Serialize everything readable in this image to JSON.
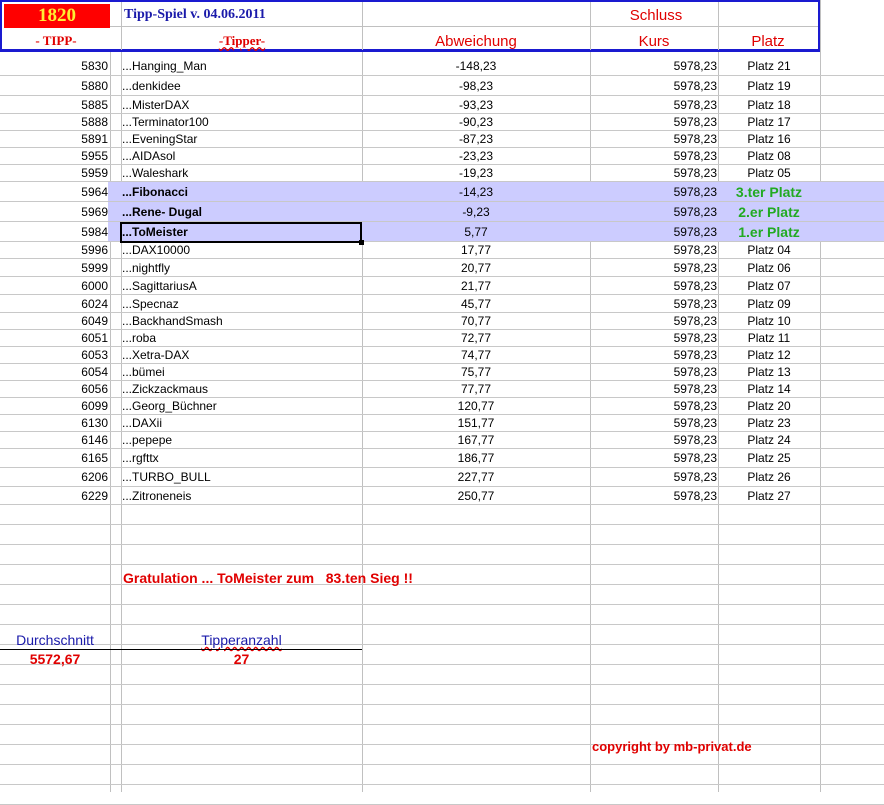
{
  "header": {
    "badge": "1820",
    "title": "Tipp-Spiel v. 04.06.2011",
    "schluss": "Schluss",
    "col_tipp": "- TIPP-",
    "col_tipper": "-Tipper-",
    "col_abweichung": "Abweichung",
    "col_kurs": "Kurs",
    "col_platz": "Platz"
  },
  "rows": [
    {
      "tipp": "5830",
      "tipper": "...Hanging_Man",
      "abw": "-148,23",
      "kurs": "5978,23",
      "platz": "Platz 21"
    },
    {
      "tipp": "5880",
      "tipper": "...denkidee",
      "abw": "-98,23",
      "kurs": "5978,23",
      "platz": "Platz 19"
    },
    {
      "tipp": "5885",
      "tipper": "...MisterDAX",
      "abw": "-93,23",
      "kurs": "5978,23",
      "platz": "Platz 18"
    },
    {
      "tipp": "5888",
      "tipper": "...Terminator100",
      "abw": "-90,23",
      "kurs": "5978,23",
      "platz": "Platz 17"
    },
    {
      "tipp": "5891",
      "tipper": "...EveningStar",
      "abw": "-87,23",
      "kurs": "5978,23",
      "platz": "Platz 16"
    },
    {
      "tipp": "5955",
      "tipper": "...AIDAsol",
      "abw": "-23,23",
      "kurs": "5978,23",
      "platz": "Platz 08"
    },
    {
      "tipp": "5959",
      "tipper": "...Waleshark",
      "abw": "-19,23",
      "kurs": "5978,23",
      "platz": "Platz 05"
    },
    {
      "tipp": "5964",
      "tipper": "...Fibonacci",
      "abw": "-14,23",
      "kurs": "5978,23",
      "platz": "3.ter Platz",
      "winner": true
    },
    {
      "tipp": "5969",
      "tipper": "...Rene- Dugal",
      "abw": "-9,23",
      "kurs": "5978,23",
      "platz": "2.er Platz",
      "winner": true
    },
    {
      "tipp": "5984",
      "tipper": "...ToMeister",
      "abw": "5,77",
      "kurs": "5978,23",
      "platz": "1.er Platz",
      "winner": true
    },
    {
      "tipp": "5996",
      "tipper": "...DAX10000",
      "abw": "17,77",
      "kurs": "5978,23",
      "platz": "Platz 04"
    },
    {
      "tipp": "5999",
      "tipper": "...nightfly",
      "abw": "20,77",
      "kurs": "5978,23",
      "platz": "Platz 06"
    },
    {
      "tipp": "6000",
      "tipper": "...SagittariusA",
      "abw": "21,77",
      "kurs": "5978,23",
      "platz": "Platz 07"
    },
    {
      "tipp": "6024",
      "tipper": "...Specnaz",
      "abw": "45,77",
      "kurs": "5978,23",
      "platz": "Platz 09"
    },
    {
      "tipp": "6049",
      "tipper": "...BackhandSmash",
      "abw": "70,77",
      "kurs": "5978,23",
      "platz": "Platz 10"
    },
    {
      "tipp": "6051",
      "tipper": "...roba",
      "abw": "72,77",
      "kurs": "5978,23",
      "platz": "Platz 11"
    },
    {
      "tipp": "6053",
      "tipper": "...Xetra-DAX",
      "abw": "74,77",
      "kurs": "5978,23",
      "platz": "Platz 12"
    },
    {
      "tipp": "6054",
      "tipper": "...bümei",
      "abw": "75,77",
      "kurs": "5978,23",
      "platz": "Platz 13"
    },
    {
      "tipp": "6056",
      "tipper": "...Zickzackmaus",
      "abw": "77,77",
      "kurs": "5978,23",
      "platz": "Platz 14"
    },
    {
      "tipp": "6099",
      "tipper": "...Georg_Büchner",
      "abw": "120,77",
      "kurs": "5978,23",
      "platz": "Platz 20"
    },
    {
      "tipp": "6130",
      "tipper": "...DAXii",
      "abw": "151,77",
      "kurs": "5978,23",
      "platz": "Platz 23"
    },
    {
      "tipp": "6146",
      "tipper": "...pepepe",
      "abw": "167,77",
      "kurs": "5978,23",
      "platz": "Platz 24"
    },
    {
      "tipp": "6165",
      "tipper": "...rgfttx",
      "abw": "186,77",
      "kurs": "5978,23",
      "platz": "Platz 25"
    },
    {
      "tipp": "6206",
      "tipper": "...TURBO_BULL",
      "abw": "227,77",
      "kurs": "5978,23",
      "platz": "Platz 26"
    },
    {
      "tipp": "6229",
      "tipper": "...Zitroneneis",
      "abw": "250,77",
      "kurs": "5978,23",
      "platz": "Platz 27"
    }
  ],
  "footer": {
    "congrats": "Gratulation ... ToMeister zum   83.ten Sieg !!",
    "avg_label": "Durchschnitt",
    "avg_value": "5572,67",
    "count_label": "Tipperanzahl",
    "count_value": "27",
    "copyright": "copyright by mb-privat.de"
  }
}
